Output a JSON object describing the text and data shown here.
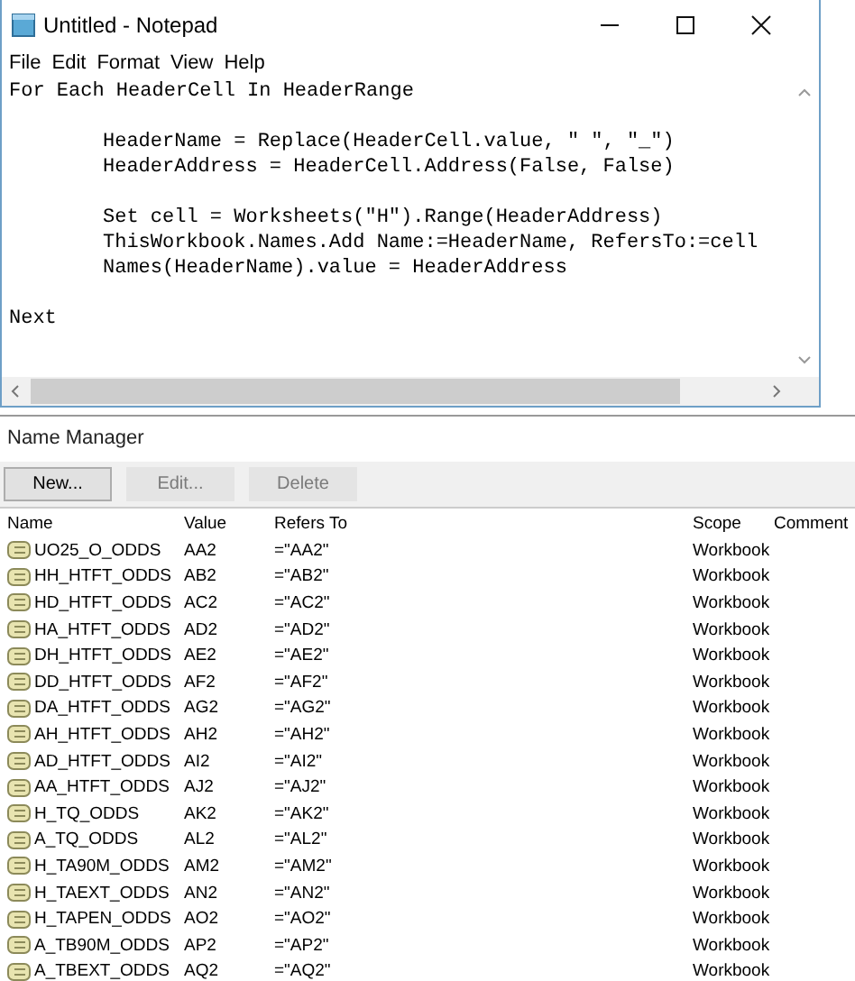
{
  "notepad": {
    "title": "Untitled - Notepad",
    "menu": [
      {
        "label": "File"
      },
      {
        "label": "Edit"
      },
      {
        "label": "Format"
      },
      {
        "label": "View"
      },
      {
        "label": "Help"
      }
    ],
    "lines": [
      {
        "text": "For Each HeaderCell In HeaderRange",
        "indented": false,
        "blank_before": false
      },
      {
        "text": "HeaderName = Replace(HeaderCell.value, \" \", \"_\")",
        "indented": true,
        "blank_before": true
      },
      {
        "text": "HeaderAddress = HeaderCell.Address(False, False)",
        "indented": true,
        "blank_before": false
      },
      {
        "text": "Set cell = Worksheets(\"H\").Range(HeaderAddress)",
        "indented": true,
        "blank_before": true
      },
      {
        "text": "ThisWorkbook.Names.Add Name:=HeaderName, RefersTo:=cell",
        "indented": true,
        "blank_before": false
      },
      {
        "text": "Names(HeaderName).value = HeaderAddress",
        "indented": true,
        "blank_before": false
      },
      {
        "text": "Next",
        "indented": false,
        "blank_before": true
      }
    ]
  },
  "name_manager": {
    "title": "Name Manager",
    "buttons": [
      {
        "label": "New...",
        "disabled": false
      },
      {
        "label": "Edit...",
        "disabled": true
      },
      {
        "label": "Delete",
        "disabled": true
      }
    ],
    "columns": [
      "Name",
      "Value",
      "Refers To",
      "Scope",
      "Comment"
    ],
    "rows": [
      {
        "name": "UO25_O_ODDS",
        "value": "AA2",
        "refers_to": "=\"AA2\"",
        "scope": "Workbook"
      },
      {
        "name": "HH_HTFT_ODDS",
        "value": "AB2",
        "refers_to": "=\"AB2\"",
        "scope": "Workbook"
      },
      {
        "name": "HD_HTFT_ODDS",
        "value": "AC2",
        "refers_to": "=\"AC2\"",
        "scope": "Workbook"
      },
      {
        "name": "HA_HTFT_ODDS",
        "value": "AD2",
        "refers_to": "=\"AD2\"",
        "scope": "Workbook"
      },
      {
        "name": "DH_HTFT_ODDS",
        "value": "AE2",
        "refers_to": "=\"AE2\"",
        "scope": "Workbook"
      },
      {
        "name": "DD_HTFT_ODDS",
        "value": "AF2",
        "refers_to": "=\"AF2\"",
        "scope": "Workbook"
      },
      {
        "name": "DA_HTFT_ODDS",
        "value": "AG2",
        "refers_to": "=\"AG2\"",
        "scope": "Workbook"
      },
      {
        "name": "AH_HTFT_ODDS",
        "value": "AH2",
        "refers_to": "=\"AH2\"",
        "scope": "Workbook"
      },
      {
        "name": "AD_HTFT_ODDS",
        "value": "AI2",
        "refers_to": "=\"AI2\"",
        "scope": "Workbook"
      },
      {
        "name": "AA_HTFT_ODDS",
        "value": "AJ2",
        "refers_to": "=\"AJ2\"",
        "scope": "Workbook"
      },
      {
        "name": "H_TQ_ODDS",
        "value": "AK2",
        "refers_to": "=\"AK2\"",
        "scope": "Workbook"
      },
      {
        "name": "A_TQ_ODDS",
        "value": "AL2",
        "refers_to": "=\"AL2\"",
        "scope": "Workbook"
      },
      {
        "name": "H_TA90M_ODDS",
        "value": "AM2",
        "refers_to": "=\"AM2\"",
        "scope": "Workbook"
      },
      {
        "name": "H_TAEXT_ODDS",
        "value": "AN2",
        "refers_to": "=\"AN2\"",
        "scope": "Workbook"
      },
      {
        "name": "H_TAPEN_ODDS",
        "value": "AO2",
        "refers_to": "=\"AO2\"",
        "scope": "Workbook"
      },
      {
        "name": "A_TB90M_ODDS",
        "value": "AP2",
        "refers_to": "=\"AP2\"",
        "scope": "Workbook"
      },
      {
        "name": "A_TBEXT_ODDS",
        "value": "AQ2",
        "refers_to": "=\"AQ2\"",
        "scope": "Workbook"
      }
    ]
  }
}
